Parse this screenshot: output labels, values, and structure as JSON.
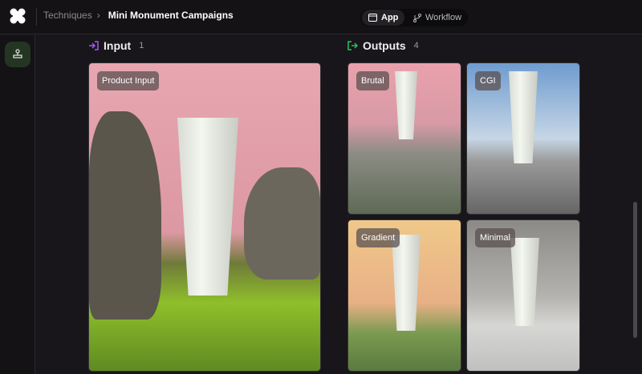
{
  "breadcrumb": {
    "parent": "Techniques",
    "current": "Mini Monument Campaigns"
  },
  "view_toggle": {
    "app": "App",
    "workflow": "Workflow",
    "active": "App"
  },
  "input": {
    "title": "Input",
    "count": "1",
    "card_label": "Product Input"
  },
  "outputs": {
    "title": "Outputs",
    "count": "4",
    "cards": [
      {
        "label": "Brutal"
      },
      {
        "label": "CGI"
      },
      {
        "label": "Gradient"
      },
      {
        "label": "Minimal"
      }
    ]
  },
  "colors": {
    "input_icon": "#a855f7",
    "output_icon": "#22c55e",
    "sidebar_active": "#243524"
  }
}
